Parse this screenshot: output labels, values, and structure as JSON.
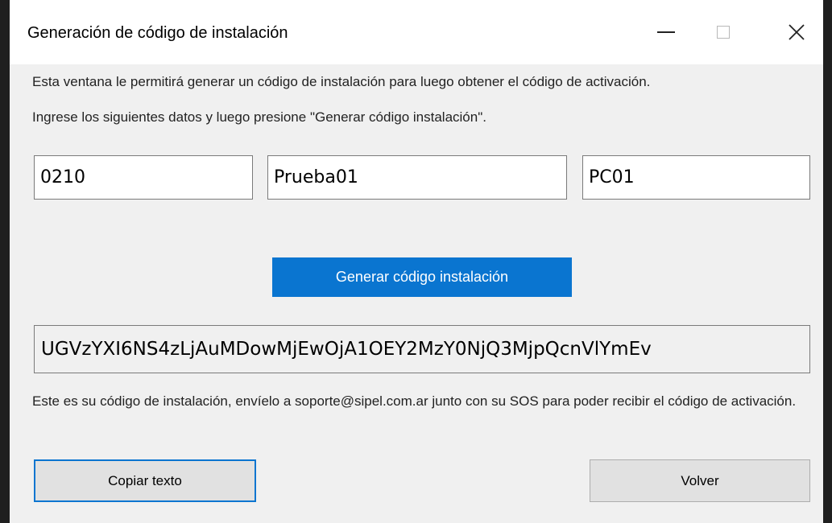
{
  "window": {
    "title": "Generación de código de instalación",
    "controls": [
      "minimize-icon",
      "maximize-icon",
      "close-icon"
    ]
  },
  "instructions": {
    "line1": "Esta ventana le permitirá generar un código de instalación para luego obtener el código de activación.",
    "line2": "Ingrese los siguientes datos y luego presione \"Generar código instalación\"."
  },
  "fields": {
    "field1_value": "0210",
    "field2_value": "Prueba01",
    "field3_value": "PC01"
  },
  "generate_button": {
    "label": "Generar código instalación"
  },
  "installation_code": {
    "value": "UGVzYXI6NS4zLjAuMDowMjEwOjA1OEY2MzY0NjQ3MjpQcnVlYmEv"
  },
  "note": {
    "text": "Este es su código de instalación, envíelo a soporte@sipel.com.ar junto con su SOS para poder recibir el código de activación."
  },
  "buttons": {
    "copy_label": "Copiar texto",
    "back_label": "Volver"
  },
  "colors": {
    "accent": "#0a75d0",
    "background": "#f0f0f0",
    "button": "#e1e1e1"
  }
}
